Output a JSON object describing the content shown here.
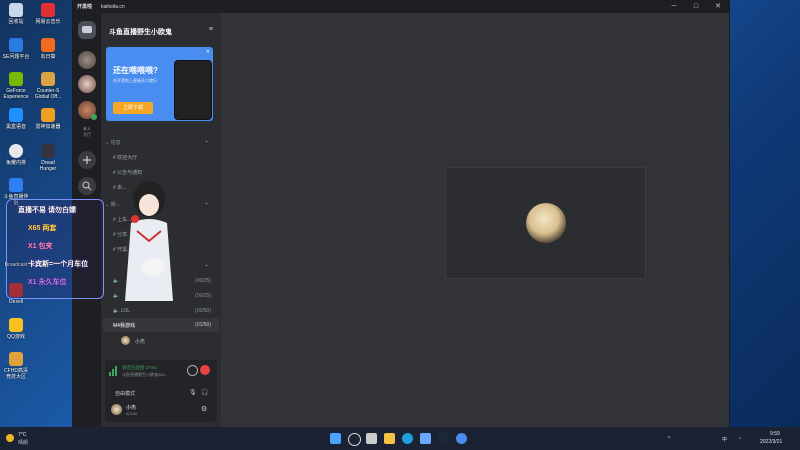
{
  "desktop": {
    "icons": [
      {
        "label": "回收站"
      },
      {
        "label": "网易云音乐"
      },
      {
        "label": "SE问题平台"
      },
      {
        "label": "向日葵"
      },
      {
        "label": "GeForce Experience"
      },
      {
        "label": "Counter-S Global Off..."
      },
      {
        "label": "N"
      },
      {
        "label": "黑盒语音"
      },
      {
        "label": "雷神加速器"
      },
      {
        "label": "安"
      },
      {
        "label": "兔耀内排"
      },
      {
        "label": "Dread Hunger"
      },
      {
        "label": "斗鱼直播伴侣"
      },
      {
        "label": "Broadcast"
      },
      {
        "label": "Dexell"
      },
      {
        "label": "QQ游戏"
      },
      {
        "label": "CFHD高清竞技大区"
      }
    ]
  },
  "window": {
    "title": "开黑啦",
    "url": "kaiheila.cn",
    "controls": [
      "─",
      "□",
      "✕"
    ]
  },
  "rail": {
    "user_label": "未入\n大厅"
  },
  "guild": {
    "name": "斗鱼直播野生小欧鬼",
    "menu_icon": "≡"
  },
  "banner": {
    "title": "还在喂喂喂?",
    "subtitle": "在开黑啦上直接开口就行",
    "button": "立即下载"
  },
  "channels": {
    "category_info": "信息",
    "items": [
      "欢迎大厅",
      "公告与通知",
      "未..."
    ],
    "category_chat": "娱...",
    "chat_items": [
      "上车...",
      "分享...",
      "开黑..."
    ],
    "voice_rows": [
      {
        "label": "",
        "count": "(00/25)"
      },
      {
        "label": "",
        "count": "(00/25)"
      },
      {
        "label": "LOL",
        "count": "(00/50)"
      }
    ],
    "active_voice": {
      "label": "M4我游戏",
      "count": "(01/50)"
    },
    "member": "小杰"
  },
  "voice_panel": {
    "status": "语音已连接 27ms",
    "sub": "斗鱼直播野生小欧鬼/M4...",
    "mode": "自由模式",
    "user_name": "小杰",
    "user_id": "#2290"
  },
  "overlay": {
    "lines": [
      "直播不易 请勿白嫖",
      "X65 两套",
      "X1 包夹",
      "卡宾斯=一个月车位",
      "X1 永久车位"
    ]
  },
  "taskbar": {
    "weather_temp": "7°C",
    "weather_text": "晴朗",
    "ime": "中",
    "time": "9:59",
    "date": "2022/3/21"
  },
  "colors": {
    "accent": "#4a8df0",
    "online": "#3ba55c",
    "danger": "#ed4245",
    "button_orange": "#f5a623"
  }
}
